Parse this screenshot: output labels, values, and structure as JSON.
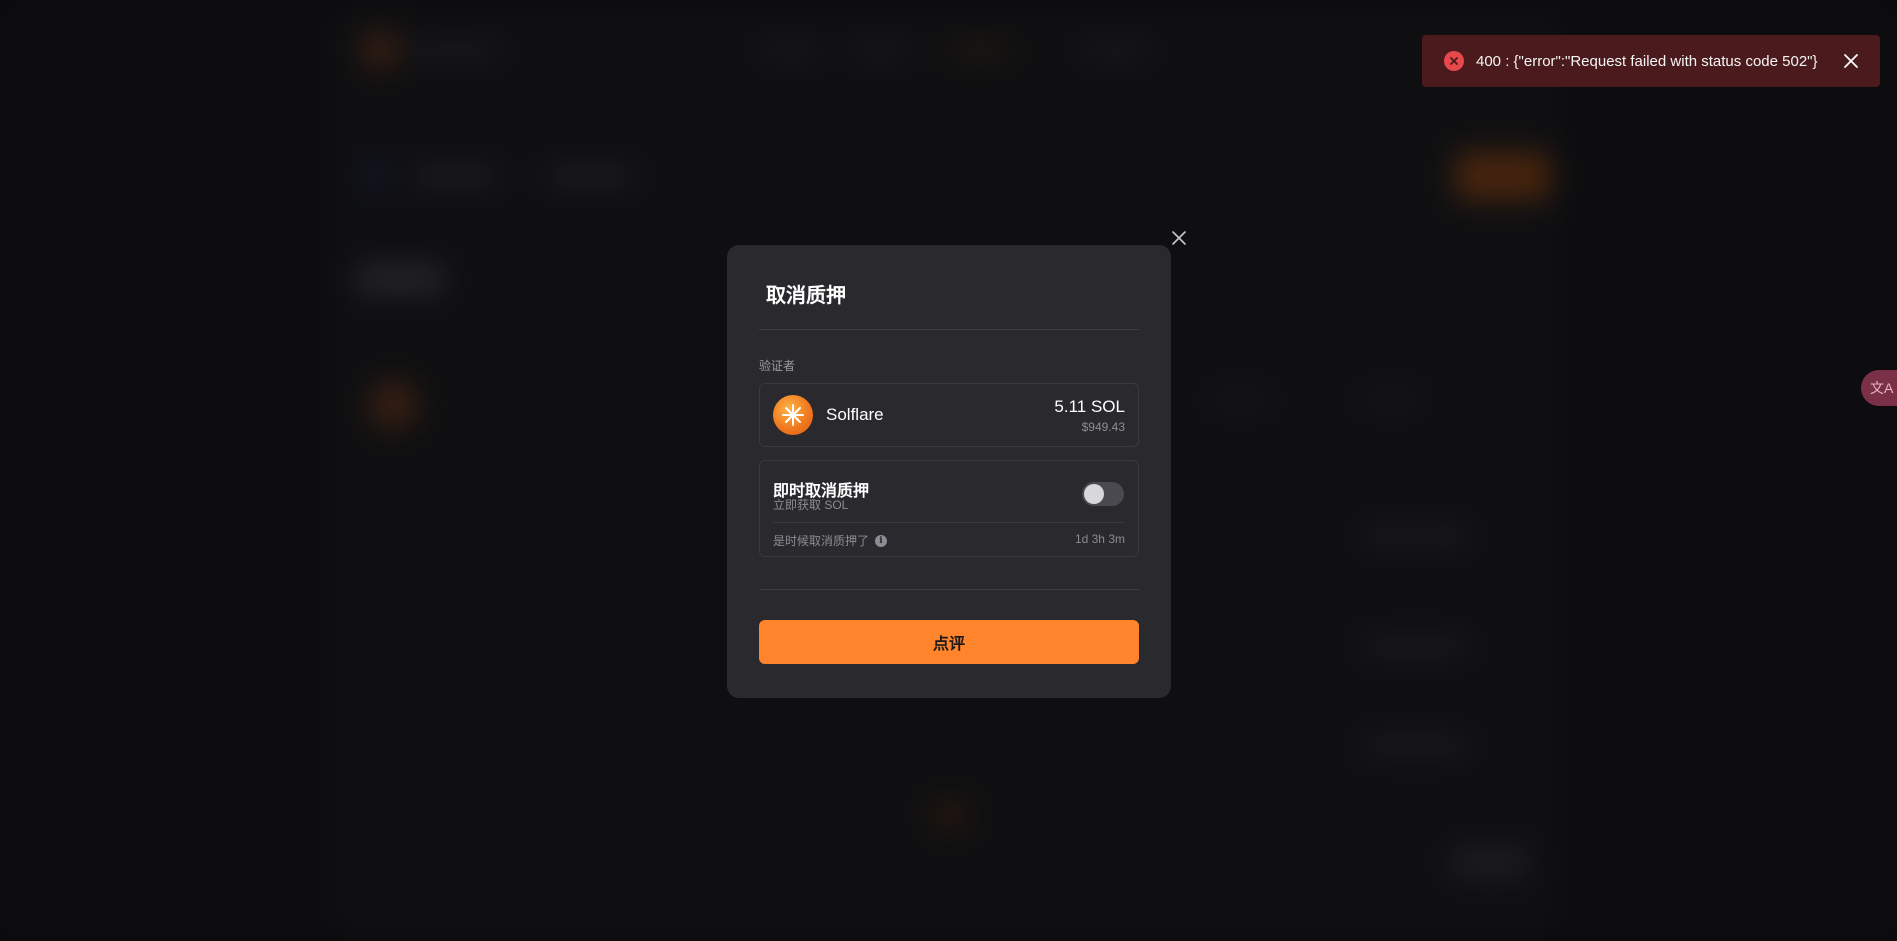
{
  "toast": {
    "message": "400 : {\"error\":\"Request failed with status code 502\"}",
    "icon": "error-circle-icon",
    "color": "#e5484d"
  },
  "translate_widget": {
    "label": "文A"
  },
  "modal": {
    "title": "取消质押",
    "validator_section_label": "验证者",
    "validator": {
      "name": "Solflare",
      "amount": "5.11 SOL",
      "usd_value": "$949.43",
      "logo_icon": "solflare-sun-icon"
    },
    "instant_unstake": {
      "title": "即时取消质押",
      "subtitle": "立即获取 SOL",
      "enabled": false,
      "note_label": "是时候取消质押了",
      "note_value": "1d 3h 3m"
    },
    "submit_label": "点评",
    "accent_color": "#ff842b"
  }
}
